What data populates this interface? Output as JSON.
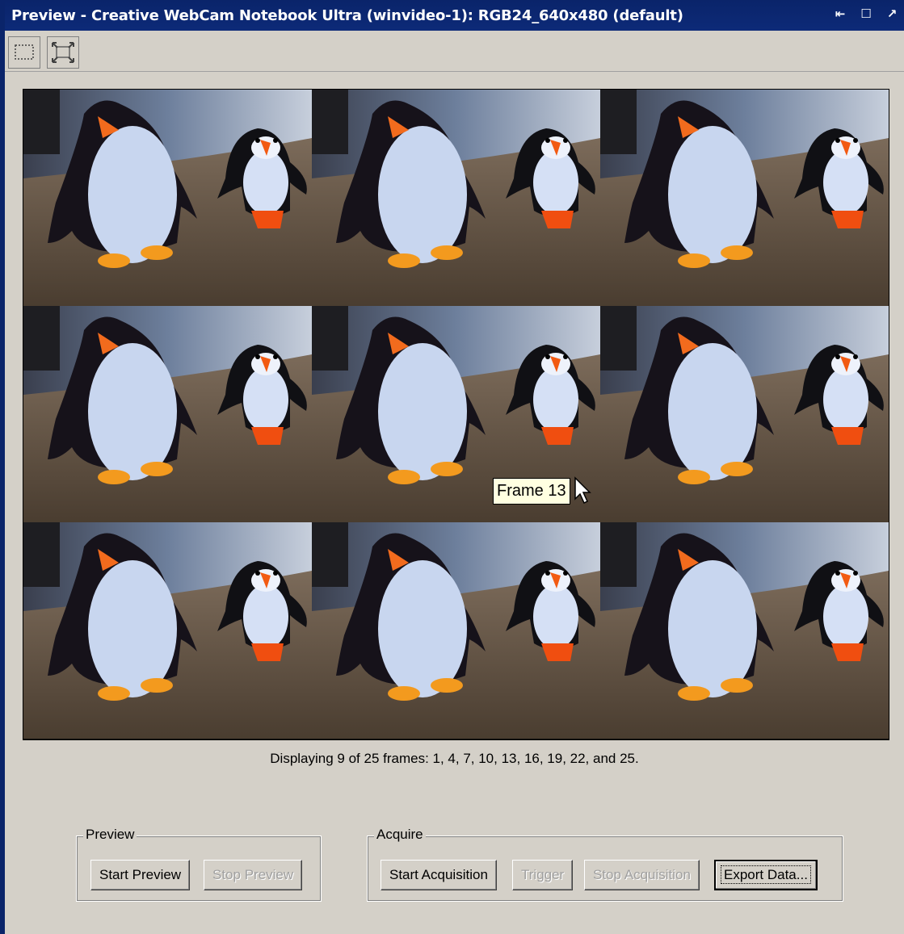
{
  "window": {
    "title": "Preview - Creative WebCam Notebook Ultra (winvideo-1): RGB24_640x480 (default)",
    "title_buttons": [
      "undock-icon",
      "maximize-icon",
      "close-icon"
    ],
    "title_glyphs": [
      "⇤",
      "☐",
      "↗"
    ]
  },
  "toolbar": {
    "tools": [
      {
        "name": "region-select-icon"
      },
      {
        "name": "fit-to-window-icon"
      }
    ]
  },
  "frames": [
    1,
    4,
    7,
    10,
    13,
    16,
    19,
    22,
    25
  ],
  "tooltip": "Frame 13",
  "status": "Displaying 9 of 25 frames: 1, 4, 7, 10, 13, 16, 19, 22, and 25.",
  "preview_group": {
    "label": "Preview",
    "start_label": "Start Preview",
    "stop_label": "Stop Preview"
  },
  "acquire_group": {
    "label": "Acquire",
    "start_label": "Start Acquisition",
    "trigger_label": "Trigger",
    "stop_label": "Stop Acquisition",
    "export_label": "Export Data..."
  },
  "colors": {
    "titlebar": "#0a246a",
    "face": "#d4d0c8",
    "tooltip_bg": "#ffffe1"
  }
}
